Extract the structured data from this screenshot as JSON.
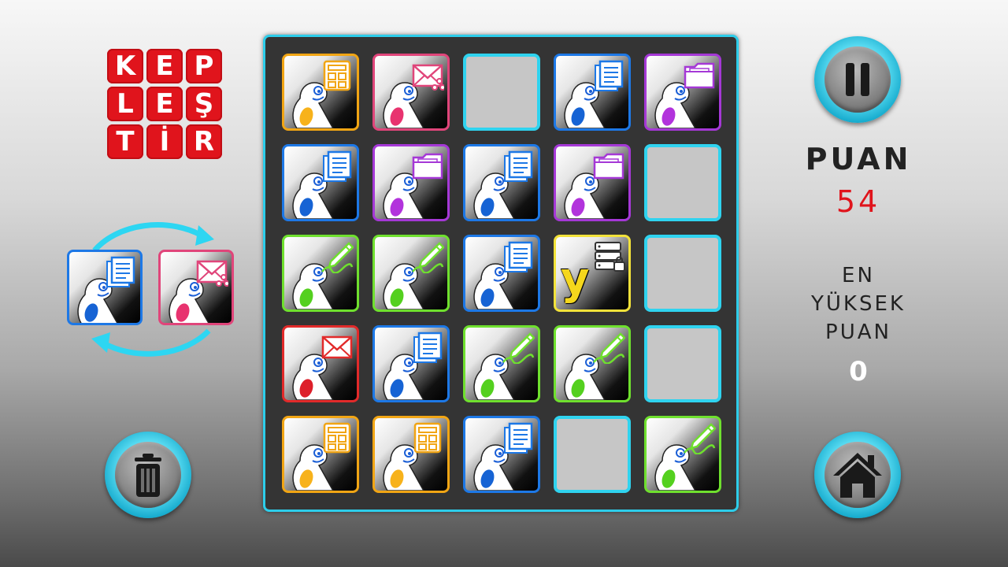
{
  "logo": {
    "rows": [
      [
        "K",
        "E",
        "P"
      ],
      [
        "L",
        "E",
        "Ş"
      ],
      [
        "T",
        "İ",
        "R"
      ]
    ]
  },
  "score": {
    "label": "PUAN",
    "value": "54"
  },
  "high_score": {
    "label_line1": "EN",
    "label_line2": "YÜKSEK",
    "label_line3": "PUAN",
    "value": "0"
  },
  "colors": {
    "accent": "#2dcdea",
    "score_value": "#e0141c",
    "logo_red": "#e0141c"
  },
  "buttons": {
    "pause": "pause-icon",
    "trash": "trash-icon",
    "home": "home-icon"
  },
  "swap_preview": [
    {
      "color": "blue",
      "icon": "document-icon"
    },
    {
      "color": "pink",
      "icon": "share-mail-icon"
    }
  ],
  "board": [
    [
      {
        "color": "orange",
        "icon": "calculator-icon"
      },
      {
        "color": "pink",
        "icon": "share-mail-icon"
      },
      null,
      {
        "color": "blue",
        "icon": "document-icon"
      },
      {
        "color": "purple",
        "icon": "folder-icon"
      }
    ],
    [
      {
        "color": "blue",
        "icon": "document-icon"
      },
      {
        "color": "purple",
        "icon": "folder-icon"
      },
      {
        "color": "blue",
        "icon": "document-icon"
      },
      {
        "color": "purple",
        "icon": "folder-icon"
      },
      null
    ],
    [
      {
        "color": "green",
        "icon": "pen-icon"
      },
      {
        "color": "green",
        "icon": "pen-icon"
      },
      {
        "color": "blue",
        "icon": "document-icon"
      },
      {
        "color": "yellow",
        "icon": "server-lock-icon",
        "letter": "y"
      },
      null
    ],
    [
      {
        "color": "red",
        "icon": "mail-icon"
      },
      {
        "color": "blue",
        "icon": "document-icon"
      },
      {
        "color": "green",
        "icon": "pen-icon"
      },
      {
        "color": "green",
        "icon": "pen-icon"
      },
      null
    ],
    [
      {
        "color": "orange",
        "icon": "calculator-icon"
      },
      {
        "color": "orange",
        "icon": "calculator-icon"
      },
      {
        "color": "blue",
        "icon": "document-icon"
      },
      null,
      {
        "color": "green",
        "icon": "pen-icon"
      }
    ]
  ]
}
